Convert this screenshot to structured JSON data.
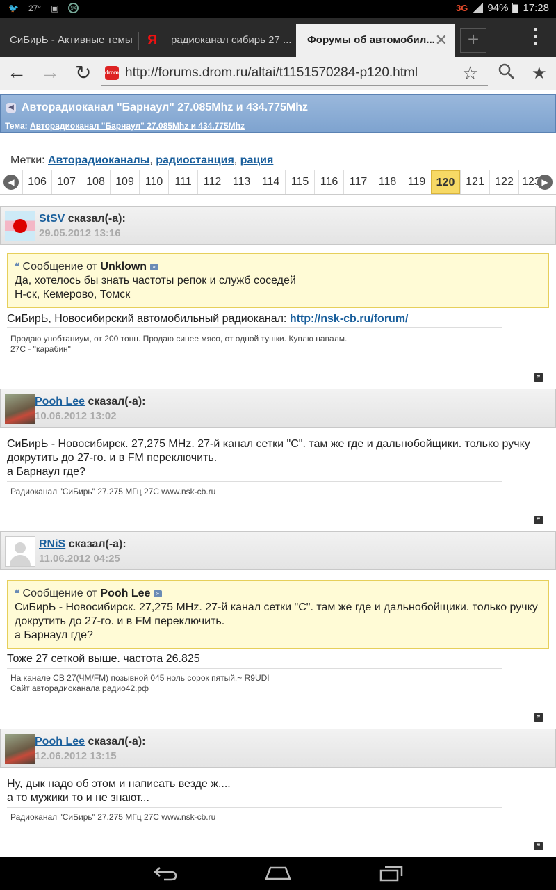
{
  "status": {
    "temp": "27°",
    "network": "3G",
    "battery": "94%",
    "time": "17:28"
  },
  "tabs": [
    {
      "label": "СиБирЬ - Активные темы"
    },
    {
      "label": "радиоканал сибирь 27 ..."
    },
    {
      "label": "Форумы об автомобил..."
    }
  ],
  "tab_close": "✕",
  "new_tab": "+",
  "url": "http://forums.drom.ru/altai/t1151570284-p120.html",
  "thread": {
    "title": "Авторадиоканал \"Барнаул\" 27.085Mhz и 434.775Mhz",
    "topic_label": "Тема:",
    "topic_link": "Авторадиоканал \"Барнаул\" 27.085Mhz и 434.775Mhz"
  },
  "tags": {
    "label": "Метки:",
    "items": [
      "Авторадиоканалы",
      "радиостанция",
      "рация"
    ]
  },
  "pagination": {
    "pages": [
      "106",
      "107",
      "108",
      "109",
      "110",
      "111",
      "112",
      "113",
      "114",
      "115",
      "116",
      "117",
      "118",
      "119",
      "120",
      "121",
      "122",
      "123"
    ],
    "current": "120"
  },
  "posts": [
    {
      "author": "StSV",
      "said": "сказал(-а):",
      "date": "29.05.2012 13:16",
      "quote": {
        "header": "Сообщение от",
        "author": "Unklown",
        "lines": [
          "Да, хотелось бы знать частоты репок и служб соседей",
          "Н-ск, Кемерово, Томск"
        ]
      },
      "text": "СиБирЬ, Новосибирский автомобильный радиоканал:",
      "link": "http://nsk-cb.ru/forum/",
      "signature": [
        "Продаю унобтаниум, от 200 тонн. Продаю синее мясо, от одной тушки. Куплю напалм.",
        "27С - \"карабин\""
      ]
    },
    {
      "author": "Pooh Lee",
      "said": "сказал(-а):",
      "date": "10.06.2012 13:02",
      "lines": [
        "СиБирЬ - Новосибирск. 27,275 MHz. 27-й канал сетки \"С\". там же где и дальнобойщики. только ручку",
        "докрутить до 27-го. и в FM переключить.",
        "а Барнаул где?"
      ],
      "signature": [
        "Радиоканал \"СиБирь\" 27.275 МГц 27С www.nsk-cb.ru"
      ]
    },
    {
      "author": "RNiS",
      "said": "сказал(-а):",
      "date": "11.06.2012 04:25",
      "quote": {
        "header": "Сообщение от",
        "author": "Pooh Lee",
        "lines": [
          "СиБирЬ - Новосибирск. 27,275 MHz. 27-й канал сетки \"С\". там же где и дальнобойщики. только ручку",
          "докрутить до 27-го. и в FM переключить.",
          "а Барнаул где?"
        ]
      },
      "text": "Тоже 27 сеткой выше. частота 26.825",
      "signature": [
        "На канале CB 27(ЧМ/FM) позывной 045 ноль сорок пятый.~ R9UDI",
        "Сайт авторадиоканала радио42.рф"
      ]
    },
    {
      "author": "Pooh Lee",
      "said": "сказал(-а):",
      "date": "12.06.2012 13:15",
      "lines": [
        "Ну, дык надо об этом и написать везде ж....",
        "а то мужики то и не знают..."
      ],
      "signature": [
        "Радиоканал \"СиБирь\" 27.275 МГц 27С www.nsk-cb.ru"
      ]
    }
  ]
}
